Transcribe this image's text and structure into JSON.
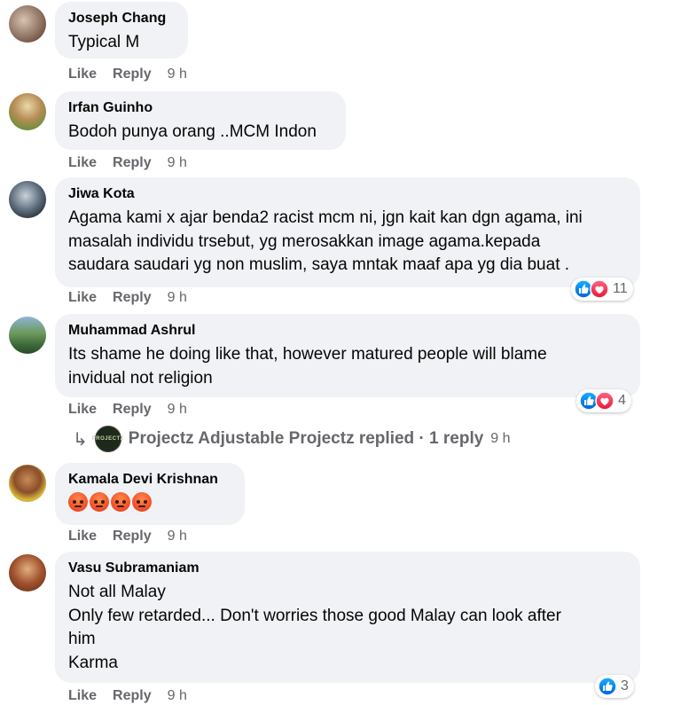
{
  "colors": {
    "bubble_bg": "#f0f2f5",
    "meta_text": "#65676b",
    "like_blue": "#1877f2",
    "love_red": "#f33e58"
  },
  "comments": [
    {
      "author": "Joseph Chang",
      "text": "Typical M",
      "actions": {
        "like": "Like",
        "reply": "Reply",
        "time": "9 h"
      }
    },
    {
      "author": "Irfan Guinho",
      "text": "Bodoh punya orang ..MCM Indon",
      "actions": {
        "like": "Like",
        "reply": "Reply",
        "time": "9 h"
      }
    },
    {
      "author": "Jiwa Kota",
      "text": "Agama kami x ajar benda2 racist mcm ni, jgn kait kan dgn agama, ini\nmasalah individu trsebut, yg merosakkan image agama.kepada\nsaudara saudari yg non muslim, saya mntak maaf apa yg dia buat .",
      "actions": {
        "like": "Like",
        "reply": "Reply",
        "time": "9 h"
      },
      "reactions": {
        "icons": [
          "like-icon",
          "love-icon"
        ],
        "count": "11"
      }
    },
    {
      "author": "Muhammad Ashrul",
      "text": "Its shame he doing like that, however matured people will blame\ninvidual not religion",
      "actions": {
        "like": "Like",
        "reply": "Reply",
        "time": "9 h"
      },
      "reactions": {
        "icons": [
          "like-icon",
          "love-icon"
        ],
        "count": "4"
      },
      "replies": {
        "text": "Projectz Adjustable Projectz replied · 1 reply",
        "time": "9 h",
        "avatar_label": "PROJECTZ"
      }
    },
    {
      "author": "Kamala Devi Krishnan",
      "emojis": [
        "angry-emoji",
        "angry-emoji",
        "angry-emoji",
        "angry-emoji"
      ],
      "actions": {
        "like": "Like",
        "reply": "Reply",
        "time": "9 h"
      }
    },
    {
      "author": "Vasu Subramaniam",
      "text": "Not all Malay\nOnly few retarded... Don't worries those good Malay can look after\nhim\nKarma",
      "actions": {
        "like": "Like",
        "reply": "Reply",
        "time": "9 h"
      },
      "reactions": {
        "icons": [
          "like-icon"
        ],
        "count": "3"
      }
    }
  ]
}
